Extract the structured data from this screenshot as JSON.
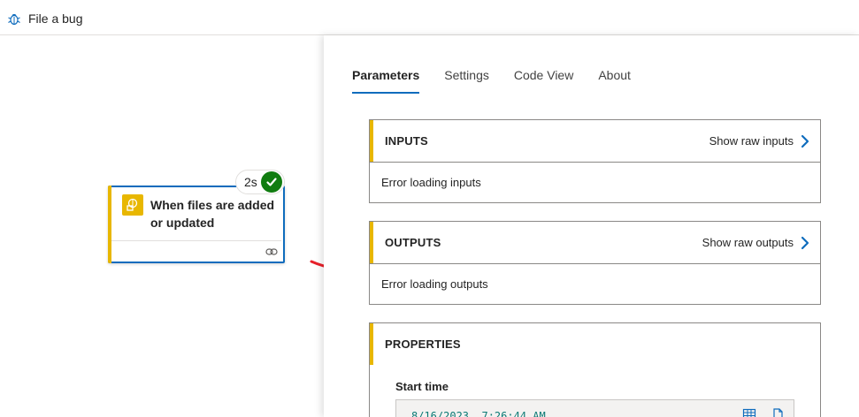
{
  "toolbar": {
    "file_bug_label": "File a bug"
  },
  "trigger": {
    "title": "When files are added or updated",
    "duration": "2s"
  },
  "panel": {
    "tabs": [
      {
        "label": "Parameters",
        "active": true
      },
      {
        "label": "Settings",
        "active": false
      },
      {
        "label": "Code View",
        "active": false
      },
      {
        "label": "About",
        "active": false
      }
    ],
    "inputs": {
      "title": "INPUTS",
      "raw_label": "Show raw inputs",
      "message": "Error loading inputs"
    },
    "outputs": {
      "title": "OUTPUTS",
      "raw_label": "Show raw outputs",
      "message": "Error loading outputs"
    },
    "properties": {
      "title": "PROPERTIES",
      "start_time_label": "Start time",
      "start_time_value": "8/16/2023, 7:26:44 AM"
    }
  },
  "colors": {
    "accent": "#0f6cbd",
    "trigger": "#e8b700",
    "success": "#107c10",
    "annotation": "#e8202a"
  }
}
